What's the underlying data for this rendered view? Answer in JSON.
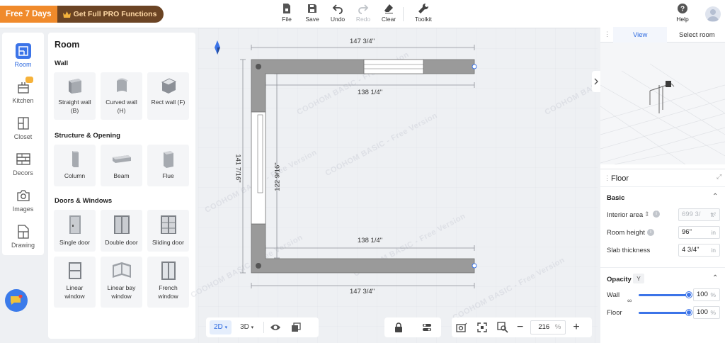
{
  "promo": {
    "free_label": "Free 7 Days",
    "pro_label": "Get Full PRO Functions"
  },
  "toolbar": {
    "file": "File",
    "save": "Save",
    "undo": "Undo",
    "redo": "Redo",
    "clear": "Clear",
    "toolkit": "Toolkit",
    "help": "Help"
  },
  "rail": {
    "items": [
      {
        "label": "Room",
        "icon": "room-icon"
      },
      {
        "label": "Kitchen",
        "icon": "kitchen-icon"
      },
      {
        "label": "Closet",
        "icon": "closet-icon"
      },
      {
        "label": "Decors",
        "icon": "decors-icon"
      },
      {
        "label": "Images",
        "icon": "camera-icon"
      },
      {
        "label": "Drawing",
        "icon": "drawing-icon"
      }
    ]
  },
  "room_panel": {
    "title": "Room",
    "wall_section": "Wall",
    "wall_items": [
      "Straight wall (B)",
      "Curved wall (H)",
      "Rect wall (F)"
    ],
    "structure_section": "Structure & Opening",
    "structure_items": [
      "Column",
      "Beam",
      "Flue"
    ],
    "doors_section": "Doors & Windows",
    "doors_items": [
      "Single door",
      "Double door",
      "Sliding door",
      "Linear window",
      "Linear bay window",
      "French window"
    ]
  },
  "canvas": {
    "dim_top": "147 3/4\"",
    "dim_inner_top": "138 1/4\"",
    "dim_left": "141 7/16\"",
    "dim_inner_left": "122 9/16\"",
    "dim_inner_bottom": "138 1/4\"",
    "dim_bottom": "147 3/4\"",
    "watermark": "COOHOM BASIC - Free Version"
  },
  "bottom": {
    "mode_2d": "2D",
    "mode_3d": "3D",
    "zoom_value": "216",
    "zoom_unit": "%"
  },
  "right_panel": {
    "tab_view": "View",
    "tab_select_room": "Select room",
    "floor_title": "Floor",
    "basic_label": "Basic",
    "interior_area_label": "Interior area",
    "interior_area_value": "699 3/",
    "room_height_label": "Room height",
    "room_height_value": "96\"",
    "room_height_unit": "in",
    "slab_thickness_label": "Slab thickness",
    "slab_thickness_value": "4 3/4\"",
    "slab_thickness_unit": "in",
    "opacity_label": "Opacity",
    "opacity_badge": "Y",
    "wall_label": "Wall",
    "wall_value": "100",
    "floor_label": "Floor",
    "floor_value": "100",
    "percent": "%",
    "wall_opacity": 1.0,
    "floor_opacity": 1.0
  },
  "colors": {
    "accent": "#3c74e8",
    "promo_orange": "#f08a2b",
    "promo_brown": "#6b4424",
    "wall_gray": "#9a9a9a"
  }
}
